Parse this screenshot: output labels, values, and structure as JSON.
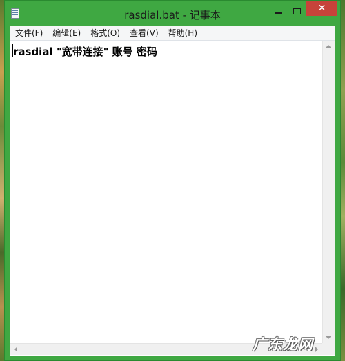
{
  "window": {
    "title": "rasdial.bat - 记事本",
    "close_glyph": "✕"
  },
  "menu": {
    "items": [
      {
        "label": "文件(F)"
      },
      {
        "label": "编辑(E)"
      },
      {
        "label": "格式(O)"
      },
      {
        "label": "查看(V)"
      },
      {
        "label": "帮助(H)"
      }
    ]
  },
  "editor": {
    "content": "rasdial \"宽带连接\" 账号 密码"
  },
  "watermark": {
    "text": "广东龙网"
  },
  "colors": {
    "frame": "#3fa842",
    "close_button": "#c7433a"
  }
}
